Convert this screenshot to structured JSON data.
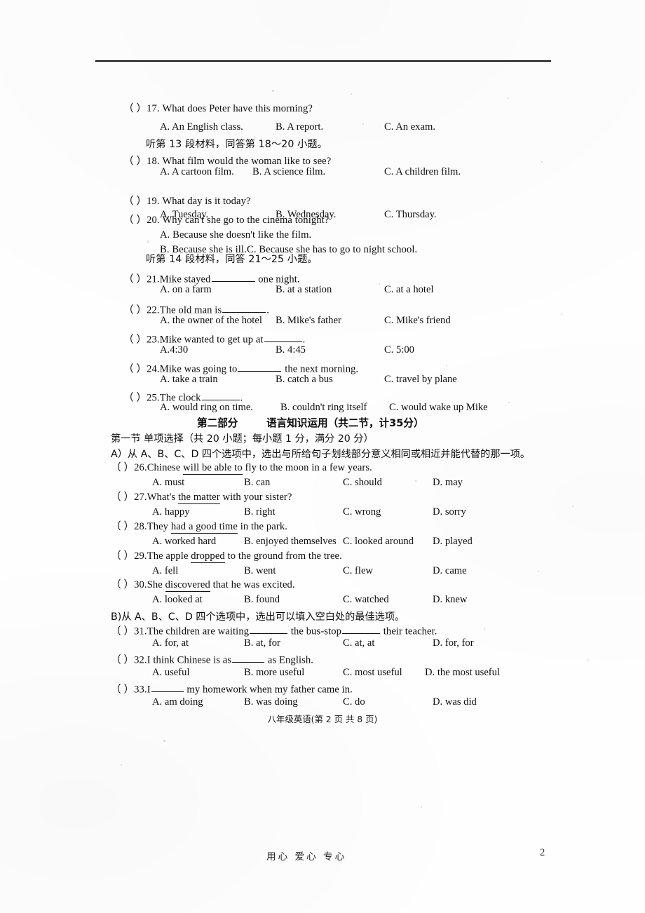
{
  "document": {
    "kind": "scanned-exam-paper",
    "footer_page_label": "八年级英语(第 2 页 共 8 页)",
    "footer_bottom_text": "用心  爱心  专心",
    "footer_page_number": "2"
  },
  "listening": {
    "questions": [
      {
        "marker": "（   ）17.",
        "stem": "What does Peter have this morning?",
        "options": [
          {
            "label": "A. An English class."
          },
          {
            "label": "B. A report."
          },
          {
            "label": "C. An exam."
          }
        ]
      },
      {
        "marker": "（   ）18.",
        "stem": "What film would the woman like to see?",
        "options": [
          {
            "label": "A. A cartoon film."
          },
          {
            "label": "B. A science film."
          },
          {
            "label": "C. A children film."
          }
        ]
      },
      {
        "marker": "（   ）19.",
        "stem": "What day is it today?",
        "options": [
          {
            "label": "A. Tuesday."
          },
          {
            "label": "B. Wednesday."
          },
          {
            "label": "C. Thursday."
          }
        ]
      },
      {
        "marker": "（   ）20.",
        "stem": "Why can't she go to the cinema tonight?",
        "options": [
          {
            "label": "A. Because she doesn't like the film."
          },
          {
            "label": "B. Because she is ill."
          },
          {
            "label": "C. Because she has to go to night school."
          }
        ]
      }
    ],
    "instruction_13": "听第 13 段材料，同答第 18～20 小题。",
    "instruction_14": "听第 14 段材料，同答 21～25 小题。",
    "questions_14": [
      {
        "marker": "（   ）21.",
        "stem_before": "Mike stayed",
        "stem_after": "one night.",
        "options": [
          {
            "label": "A. on a farm"
          },
          {
            "label": "B. at a station"
          },
          {
            "label": "C. at a hotel"
          }
        ]
      },
      {
        "marker": "（   ）22.",
        "stem_before": "The old man is",
        "stem_after": ".",
        "options": [
          {
            "label": "A. the owner of the hotel"
          },
          {
            "label": "B. Mike's father"
          },
          {
            "label": "C. Mike's friend"
          }
        ]
      },
      {
        "marker": "（   ）23.",
        "stem_before": "Mike wanted to get up at",
        "stem_after": ".",
        "options": [
          {
            "label": "A.4:30"
          },
          {
            "label": "B. 4:45"
          },
          {
            "label": "C. 5:00"
          }
        ]
      },
      {
        "marker": "（   ）24.",
        "stem_before": "Mike was going to",
        "stem_after": "the next morning.",
        "options": [
          {
            "label": "A. take a train"
          },
          {
            "label": "B. catch a bus"
          },
          {
            "label": "C. travel by plane"
          }
        ]
      },
      {
        "marker": "（   ）25.",
        "stem_before": "The clock",
        "stem_after": ".",
        "options": [
          {
            "label": "A. would ring on time."
          },
          {
            "label": "B. couldn't ring itself"
          },
          {
            "label": "C. would wake up Mike"
          }
        ]
      }
    ]
  },
  "part_two": {
    "title_left": "第二部分",
    "title_right": "语言知识运用（共二节，计35分）",
    "section_one": "第一节 单项选择（共 20 小题；每小题 1 分，满分 20 分）",
    "group_a_instruction": "A）从 A、B、C、D 四个选项中，选出与所给句子划线部分意义相同或相近并能代替的那一项。",
    "group_b_instruction": "B)从 A、B、C、D 四个选项中，选出可以填入空白处的最佳选项。",
    "group_a_questions": [
      {
        "marker": "（  ）26.",
        "stem_pre": "Chinese ",
        "stem_underlined": "will be able to",
        "stem_post": " fly to the moon in a few years.",
        "options": [
          {
            "label": "A. must"
          },
          {
            "label": "B. can"
          },
          {
            "label": "C. should"
          },
          {
            "label": "D. may"
          }
        ]
      },
      {
        "marker": "（  ）27.",
        "stem_pre": "What's ",
        "stem_underlined": "the matter",
        "stem_post": " with your sister?",
        "options": [
          {
            "label": "A. happy"
          },
          {
            "label": "B. right"
          },
          {
            "label": "C. wrong"
          },
          {
            "label": "D. sorry"
          }
        ]
      },
      {
        "marker": "（  ）28.",
        "stem_pre": "They ",
        "stem_underlined": "had a good time",
        "stem_post": " in the park.",
        "options": [
          {
            "label": "A. worked hard"
          },
          {
            "label": "B. enjoyed themselves"
          },
          {
            "label": "C. looked around"
          },
          {
            "label": "D. played"
          }
        ]
      },
      {
        "marker": "（  ）29.",
        "stem_pre": "The apple ",
        "stem_underlined": "dropped",
        "stem_post": " to the ground from the tree.",
        "options": [
          {
            "label": "A. fell"
          },
          {
            "label": "B. went"
          },
          {
            "label": "C. flew"
          },
          {
            "label": "D. came"
          }
        ]
      },
      {
        "marker": "（  ）30.",
        "stem_pre": "She ",
        "stem_underlined": "discovered",
        "stem_post": " that he was excited.",
        "options": [
          {
            "label": "A. looked at"
          },
          {
            "label": "B. found"
          },
          {
            "label": "C. watched"
          },
          {
            "label": "D. knew"
          }
        ]
      }
    ],
    "group_b_questions": [
      {
        "marker": "（   ）31.",
        "stem_a": "The children are waiting",
        "stem_b": "the bus-stop",
        "stem_c": "their teacher.",
        "options": [
          {
            "label": "A. for, at"
          },
          {
            "label": "B. at, for"
          },
          {
            "label": "C. at, at"
          },
          {
            "label": "D. for, for"
          }
        ]
      },
      {
        "marker": "（  ）32.",
        "stem_a": "I think Chinese is as",
        "stem_b": "as English.",
        "stem_c": "",
        "options": [
          {
            "label": "A. useful"
          },
          {
            "label": "B. more useful"
          },
          {
            "label": "C. most useful"
          },
          {
            "label": "D. the most useful"
          }
        ]
      },
      {
        "marker": "（  ）33.",
        "stem_a": "I",
        "stem_b": "my homework when my father came in.",
        "stem_c": "",
        "options": [
          {
            "label": "A. am doing"
          },
          {
            "label": "B. was doing"
          },
          {
            "label": "C. do"
          },
          {
            "label": "D. was did"
          }
        ]
      }
    ]
  }
}
